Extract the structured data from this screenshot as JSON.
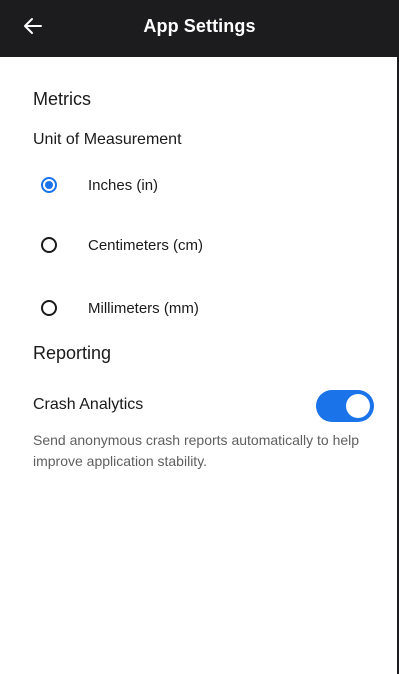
{
  "header": {
    "title": "App Settings",
    "back_icon": "arrow-left-icon"
  },
  "metrics": {
    "section_title": "Metrics",
    "unit_label": "Unit of Measurement",
    "options": [
      {
        "label": "Inches (in)",
        "selected": true
      },
      {
        "label": "Centimeters (cm)",
        "selected": false
      },
      {
        "label": "Millimeters (mm)",
        "selected": false
      }
    ]
  },
  "reporting": {
    "section_title": "Reporting",
    "crash_analytics": {
      "label": "Crash Analytics",
      "enabled": true,
      "description": "Send anonymous crash reports automatically to help improve application stability."
    }
  },
  "colors": {
    "appbar": "#1c1c1e",
    "accent": "#1a73e8"
  }
}
